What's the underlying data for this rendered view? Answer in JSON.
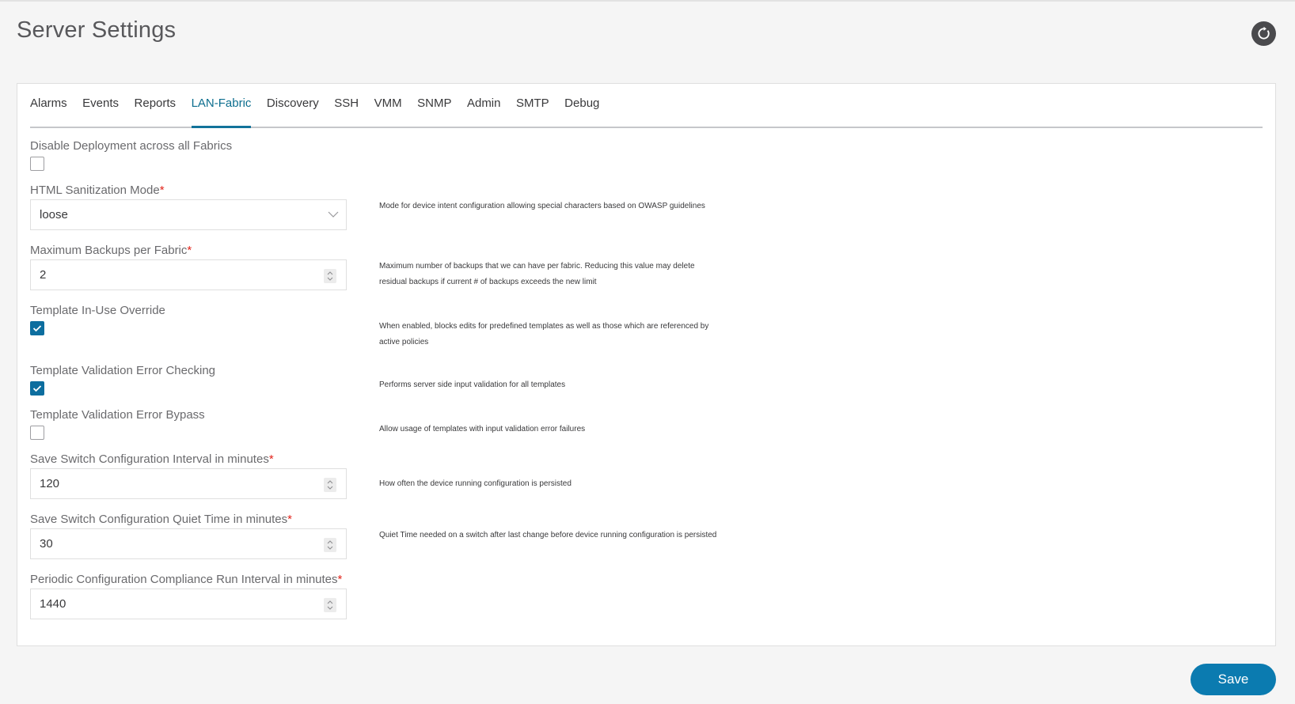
{
  "page": {
    "title": "Server Settings",
    "refresh_icon": "refresh-icon"
  },
  "tabs": [
    {
      "label": "Alarms",
      "active": false
    },
    {
      "label": "Events",
      "active": false
    },
    {
      "label": "Reports",
      "active": false
    },
    {
      "label": "LAN-Fabric",
      "active": true
    },
    {
      "label": "Discovery",
      "active": false
    },
    {
      "label": "SSH",
      "active": false
    },
    {
      "label": "VMM",
      "active": false
    },
    {
      "label": "SNMP",
      "active": false
    },
    {
      "label": "Admin",
      "active": false
    },
    {
      "label": "SMTP",
      "active": false
    },
    {
      "label": "Debug",
      "active": false
    }
  ],
  "fields": {
    "disable_deployment": {
      "label": "Disable Deployment across all Fabrics",
      "checked": false
    },
    "html_sanitization": {
      "label": "HTML Sanitization Mode",
      "required_mark": "*",
      "value": "loose",
      "help": "Mode for device intent configuration allowing special characters based on OWASP guidelines"
    },
    "max_backups": {
      "label": "Maximum Backups per Fabric",
      "required_mark": "*",
      "value": "2",
      "help": "Maximum number of backups that we can have per fabric. Reducing this value may delete residual backups if current # of backups exceeds the new limit"
    },
    "template_inuse_override": {
      "label": "Template In-Use Override",
      "checked": true,
      "help": "When enabled, blocks edits for predefined templates as well as those which are referenced by active policies"
    },
    "template_validation_checking": {
      "label": "Template Validation Error Checking",
      "checked": true,
      "help": "Performs server side input validation for all templates"
    },
    "template_validation_bypass": {
      "label": "Template Validation Error Bypass",
      "checked": false,
      "help": "Allow usage of templates with input validation error failures"
    },
    "save_interval": {
      "label": "Save Switch Configuration Interval in minutes",
      "required_mark": "*",
      "value": "120",
      "help": "How often the device running configuration is persisted"
    },
    "save_quiet_time": {
      "label": "Save Switch Configuration Quiet Time in minutes",
      "required_mark": "*",
      "value": "30",
      "help": "Quiet Time needed on a switch after last change before device running configuration is persisted"
    },
    "compliance_interval": {
      "label": "Periodic Configuration Compliance Run Interval in minutes",
      "required_mark": "*",
      "value": "1440"
    }
  },
  "footer": {
    "save_label": "Save"
  },
  "colors": {
    "accent": "#0d6e9f",
    "save_button": "#0b7bb0",
    "required": "#e2231a"
  }
}
